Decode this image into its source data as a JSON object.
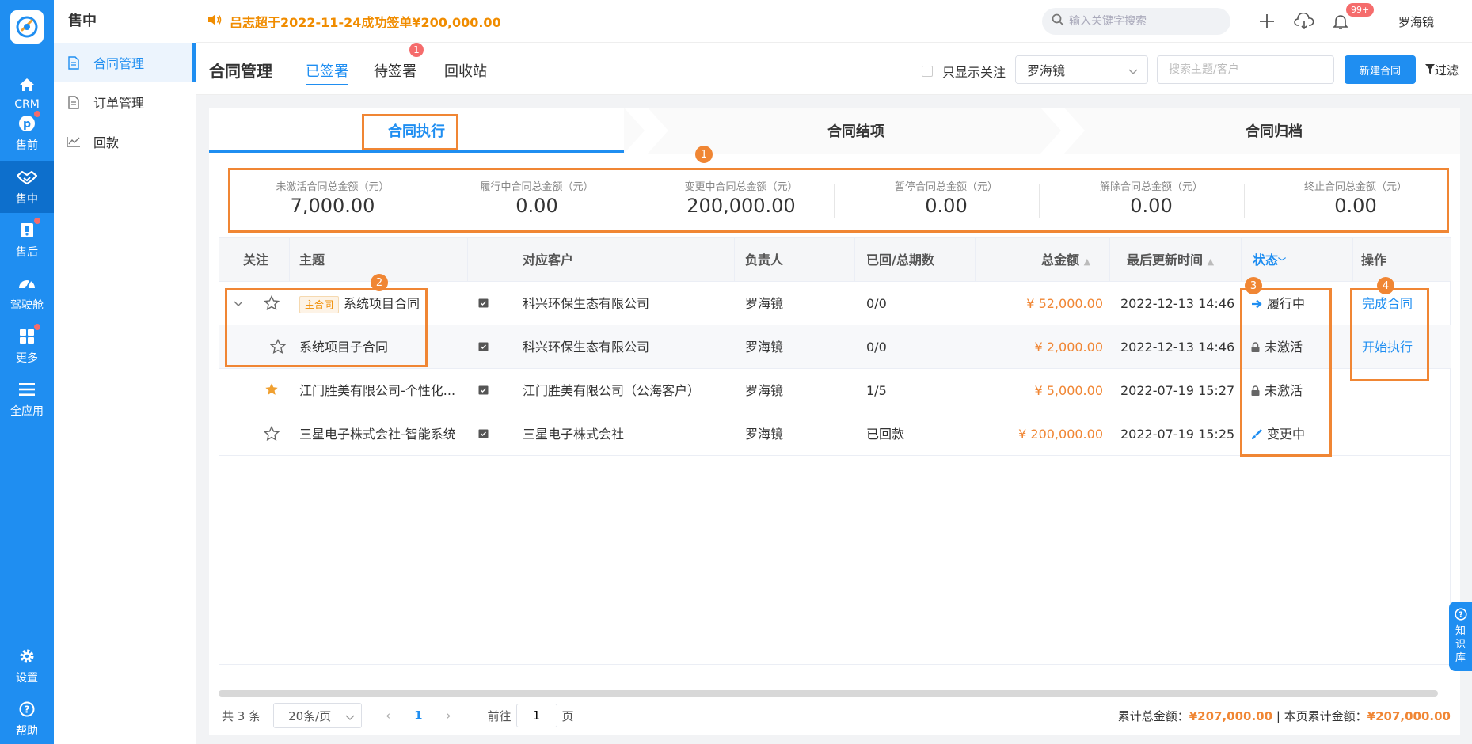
{
  "rail": {
    "items": [
      {
        "label": "CRM",
        "icon": "home-icon"
      },
      {
        "label": "售前",
        "icon": "pinterest-icon"
      },
      {
        "label": "售中",
        "icon": "handshake-icon"
      },
      {
        "label": "售后",
        "icon": "service-icon"
      },
      {
        "label": "驾驶舱",
        "icon": "dashboard-icon"
      },
      {
        "label": "更多",
        "icon": "grid-icon"
      },
      {
        "label": "全应用",
        "icon": "list-icon"
      },
      {
        "label": "设置",
        "icon": "gear-icon"
      },
      {
        "label": "帮助",
        "icon": "help-icon"
      }
    ]
  },
  "menu": {
    "title": "售中",
    "items": [
      {
        "label": "合同管理"
      },
      {
        "label": "订单管理"
      },
      {
        "label": "回款"
      }
    ]
  },
  "topbar": {
    "notice": "吕志超于2022-11-24成功签单¥200,000.00",
    "search_placeholder": "输入关键字搜索",
    "badge": "99+",
    "username": "罗海镜"
  },
  "page": {
    "title": "合同管理",
    "tabs": [
      {
        "label": "已签署"
      },
      {
        "label": "待签署",
        "badge": "1"
      },
      {
        "label": "回收站"
      }
    ],
    "only_follow_label": "只显示关注",
    "owner_value": "罗海镜",
    "subject_search_placeholder": "搜索主题/客户",
    "new_button": "新建合同",
    "filter_label": "过滤"
  },
  "steps": [
    {
      "label": "合同执行"
    },
    {
      "label": "合同结项"
    },
    {
      "label": "合同归档"
    }
  ],
  "annotations": [
    "1",
    "2",
    "3",
    "4"
  ],
  "stats": [
    {
      "label": "未激活合同总金额（元）",
      "value": "7,000.00"
    },
    {
      "label": "履行中合同总金额（元）",
      "value": "0.00"
    },
    {
      "label": "变更中合同总金额（元）",
      "value": "200,000.00"
    },
    {
      "label": "暂停合同总金额（元）",
      "value": "0.00"
    },
    {
      "label": "解除合同总金额（元）",
      "value": "0.00"
    },
    {
      "label": "终止合同总金额（元）",
      "value": "0.00"
    }
  ],
  "table": {
    "headers": {
      "follow": "关注",
      "subject": "主题",
      "customer": "对应客户",
      "owner": "负责人",
      "periods": "已回/总期数",
      "amount": "总金额",
      "updated": "最后更新时间",
      "status": "状态",
      "ops": "操作"
    },
    "main_tag": "主合同",
    "rows": [
      {
        "subject": "系统项目合同",
        "customer": "科兴环保生态有限公司",
        "owner": "罗海镜",
        "periods": "0/0",
        "amount": "¥ 52,000.00",
        "updated": "2022-12-13 14:46",
        "status": "履行中",
        "op": "完成合同"
      },
      {
        "subject": "系统项目子合同",
        "customer": "科兴环保生态有限公司",
        "owner": "罗海镜",
        "periods": "0/0",
        "amount": "¥ 2,000.00",
        "updated": "2022-12-13 14:46",
        "status": "未激活",
        "op": "开始执行"
      },
      {
        "subject": "江门胜美有限公司-个性化...",
        "customer": "江门胜美有限公司（公海客户）",
        "owner": "罗海镜",
        "periods": "1/5",
        "amount": "¥ 5,000.00",
        "updated": "2022-07-19 15:27",
        "status": "未激活",
        "op": ""
      },
      {
        "subject": "三星电子株式会社-智能系统",
        "customer": "三星电子株式会社",
        "owner": "罗海镜",
        "periods": "已回款",
        "amount": "¥ 200,000.00",
        "updated": "2022-07-19 15:25",
        "status": "变更中",
        "op": ""
      }
    ]
  },
  "pager": {
    "total": "共 3 条",
    "page_size": "20条/页",
    "current": "1",
    "goto_prefix": "前往",
    "goto_value": "1",
    "goto_suffix": "页"
  },
  "totals": {
    "sum_label": "累计总金额：",
    "sum_value": "¥207,000.00",
    "sep": " | ",
    "page_label": "本页累计金额：",
    "page_value": "¥207,000.00"
  },
  "kb_float": [
    "知",
    "识",
    "库"
  ]
}
